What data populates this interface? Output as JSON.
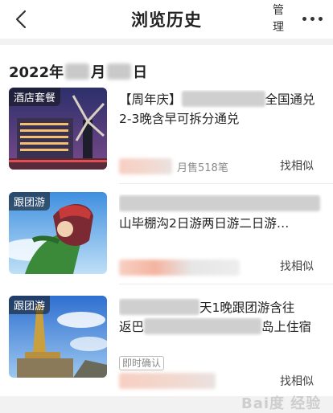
{
  "header": {
    "title": "浏览历史",
    "manage_label": "管理",
    "back_icon": "chevron-left-icon",
    "more_icon": "more-dots-icon"
  },
  "history": {
    "date_year": "2022年",
    "date_month_suffix": "月",
    "date_day_suffix": "日",
    "items": [
      {
        "tag": "酒店套餐",
        "title_prefix": "【周年庆】",
        "title_suffix": "全国通兑",
        "title_line2": "2-3晚含早可拆分通兑",
        "sales_text": "月售518笔",
        "similar_label": "找相似"
      },
      {
        "tag": "跟团游",
        "title_line2": "山毕棚沟2日游两日游二日游…",
        "similar_label": "找相似"
      },
      {
        "tag": "跟团游",
        "title_line1_part": "天1晚跟团游含往",
        "title_line2_prefix": "返巴",
        "title_line2_suffix": "岛上住宿",
        "badge": "即时确认",
        "similar_label": "找相似"
      }
    ]
  },
  "colors": {
    "background": "#f2f2f2",
    "card": "#ffffff",
    "text": "#222222",
    "muted": "#8a8a8a",
    "price_blur": "#f7cfc2"
  }
}
